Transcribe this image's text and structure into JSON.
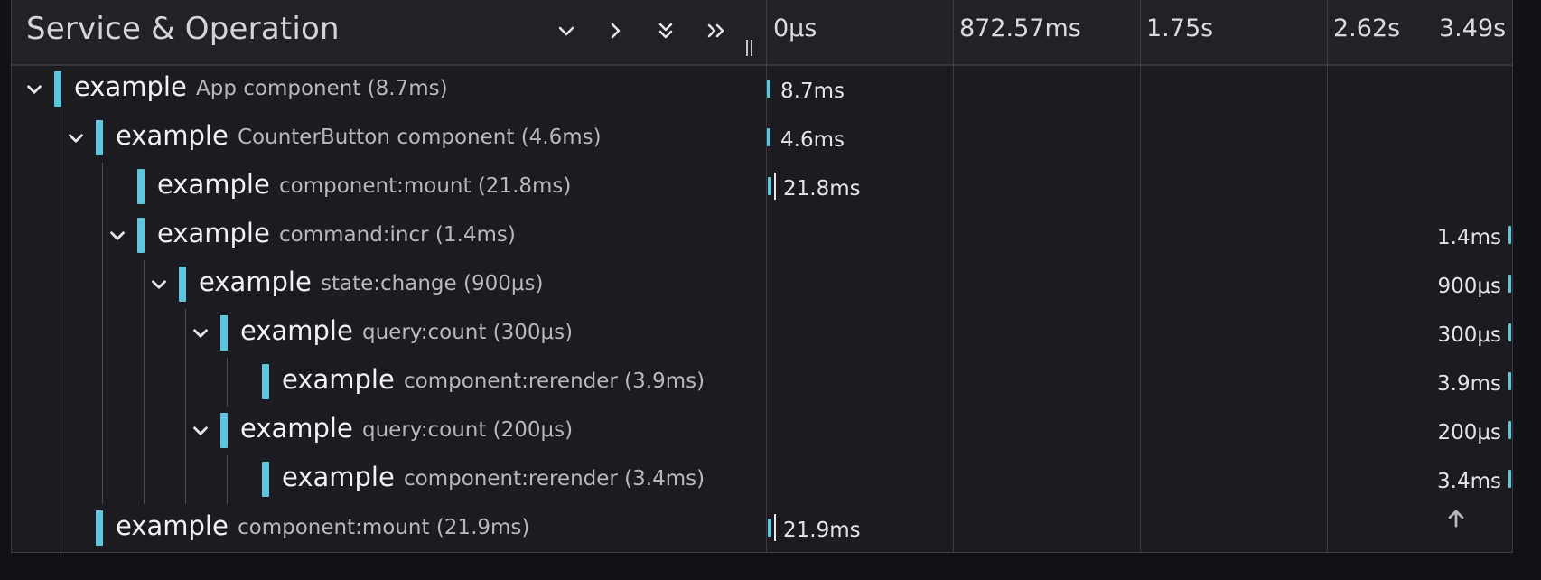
{
  "header": {
    "title": "Service & Operation",
    "ticks": [
      "0μs",
      "872.57ms",
      "1.75s",
      "2.62s",
      "3.49s"
    ]
  },
  "colors": {
    "accent": "#5ec6dc",
    "background": "#1b1c21",
    "header": "#212227"
  },
  "spans": [
    {
      "service": "example",
      "operation": "App component (8.7ms)",
      "duration": "8.7ms"
    },
    {
      "service": "example",
      "operation": "CounterButton component (4.6ms)",
      "duration": "4.6ms"
    },
    {
      "service": "example",
      "operation": "component:mount (21.8ms)",
      "duration": "21.8ms"
    },
    {
      "service": "example",
      "operation": "command:incr (1.4ms)",
      "duration": "1.4ms"
    },
    {
      "service": "example",
      "operation": "state:change (900μs)",
      "duration": "900μs"
    },
    {
      "service": "example",
      "operation": "query:count (300μs)",
      "duration": "300μs"
    },
    {
      "service": "example",
      "operation": "component:rerender (3.9ms)",
      "duration": "3.9ms"
    },
    {
      "service": "example",
      "operation": "query:count (200μs)",
      "duration": "200μs"
    },
    {
      "service": "example",
      "operation": "component:rerender (3.4ms)",
      "duration": "3.4ms"
    },
    {
      "service": "example",
      "operation": "component:mount (21.9ms)",
      "duration": "21.9ms"
    }
  ]
}
